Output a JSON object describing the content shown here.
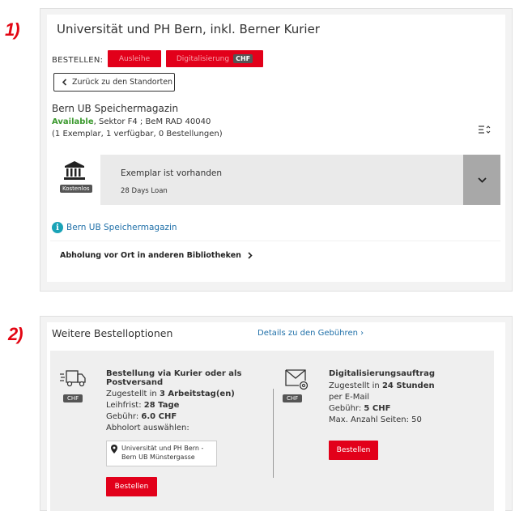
{
  "annotations": {
    "first": "1)",
    "second": "2)"
  },
  "library": {
    "title": "Universität und PH Bern, inkl. Berner Kurier",
    "order_label": "BESTELLEN:",
    "order_buttons": {
      "loan": "Ausleihe",
      "digitization": "Digitalisierung",
      "digitization_badge": "CHF"
    },
    "back_label": "Zurück zu den Standorten"
  },
  "location": {
    "name": "Bern UB Speichermagazin",
    "status": "Available",
    "shelf": ", Sektor F4 ; BeM RAD 40040",
    "copies": "(1 Exemplar, 1 verfügbar, 0 Bestellungen)"
  },
  "copy": {
    "badge": "Kostenlos",
    "status": "Exemplar ist vorhanden",
    "loan": "28 Days Loan"
  },
  "info_link": "Bern UB Speichermagazin",
  "pickup_other": "Abholung vor Ort in anderen Bibliotheken",
  "more_options": {
    "title": "Weitere Bestelloptionen",
    "fees_link": "Details zu den Gebühren",
    "courier": {
      "badge": "CHF",
      "title": "Bestellung via Kurier oder als Postversand",
      "delivered_prefix": "Zugestellt in ",
      "delivered_value": "3 Arbeitstag(en)",
      "loan_prefix": "Leihfrist: ",
      "loan_value": "28 Tage",
      "fee_prefix": "Gebühr: ",
      "fee_value": "6.0  CHF",
      "pickup_prompt": "Abholort auswählen:",
      "pickup_value": "Universität und PH Bern - Bern UB Münstergasse",
      "order_button": "Bestellen"
    },
    "digitization": {
      "badge": "CHF",
      "title": "Digitalisierungsauftrag",
      "delivered_prefix": "Zugestellt in ",
      "delivered_value": "24 Stunden",
      "via": "per E-Mail",
      "fee_prefix": "Gebühr: ",
      "fee_value": "5  CHF",
      "max_pages": "Max. Anzahl Seiten: 50",
      "order_button": "Bestellen"
    }
  },
  "colors": {
    "accent_red": "#e2001a",
    "available_green": "#3c9a2f",
    "link_blue": "#1e6fa8"
  }
}
